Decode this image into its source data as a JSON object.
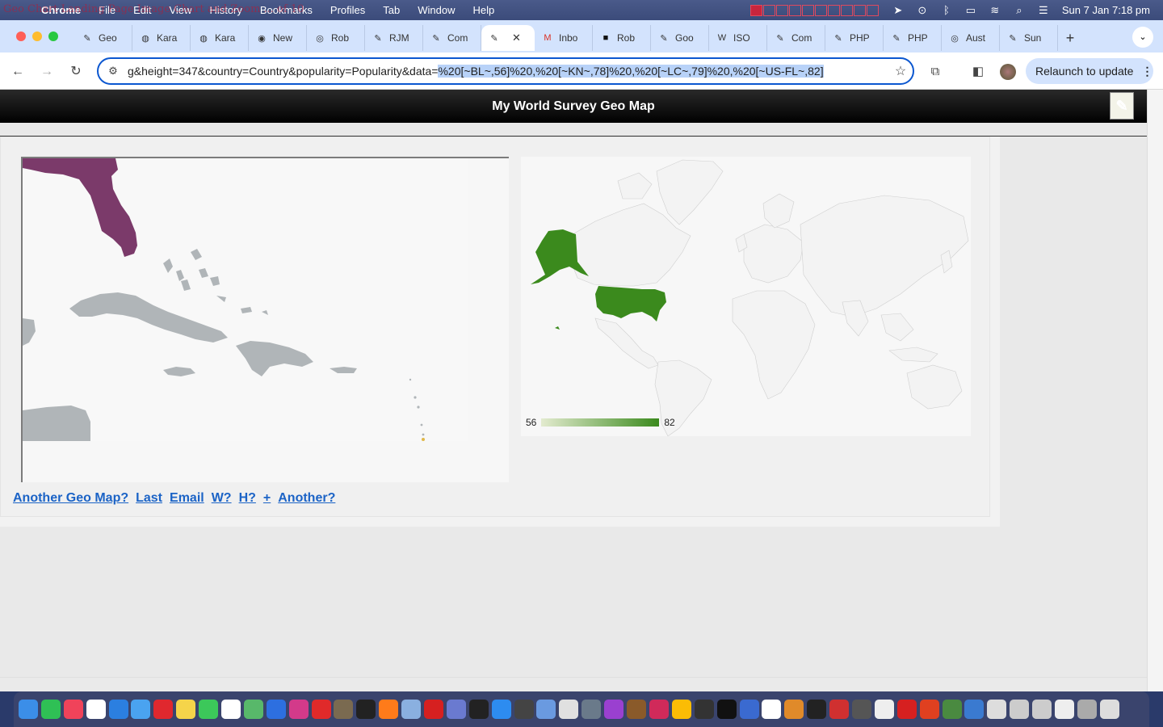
{
  "menubar": {
    "overlay_text": "Geo Chart Landing Page Image Chart and Zoom ... of 10",
    "items": [
      "Chrome",
      "File",
      "Edit",
      "View",
      "History",
      "Bookmarks",
      "Profiles",
      "Tab",
      "Window",
      "Help"
    ],
    "clock": "Sun 7 Jan  7:18 pm"
  },
  "tabs": [
    {
      "label": "Geo",
      "icon": "pencil-favicon-icon"
    },
    {
      "label": "Kara",
      "icon": "globe-favicon-icon"
    },
    {
      "label": "Kara",
      "icon": "globe-favicon-icon"
    },
    {
      "label": "New",
      "icon": "chrome-favicon-icon"
    },
    {
      "label": "Rob",
      "icon": "circle-favicon-icon"
    },
    {
      "label": "RJM",
      "icon": "pencil-favicon-icon"
    },
    {
      "label": "Com",
      "icon": "pencil-favicon-icon"
    },
    {
      "label": "",
      "icon": "pencil-favicon-icon",
      "active": true
    },
    {
      "label": "Inbo",
      "icon": "gmail-favicon-icon"
    },
    {
      "label": "Rob",
      "icon": "dark-favicon-icon"
    },
    {
      "label": "Goo",
      "icon": "pencil-favicon-icon"
    },
    {
      "label": "ISO",
      "icon": "wikipedia-favicon-icon"
    },
    {
      "label": "Com",
      "icon": "pencil-favicon-icon"
    },
    {
      "label": "PHP",
      "icon": "pencil-favicon-icon"
    },
    {
      "label": "PHP",
      "icon": "pencil-favicon-icon"
    },
    {
      "label": "Aust",
      "icon": "circle-favicon-icon"
    },
    {
      "label": "Sun",
      "icon": "pencil-favicon-icon"
    }
  ],
  "address": {
    "url_prefix": "g&height=347&country=Country&popularity=Popularity&data=",
    "url_selected": "%20[~BL~,56]%20,%20[~KN~,78]%20,%20[~LC~,79]%20,%20[~US-FL~,82]"
  },
  "toolbar": {
    "relaunch_label": "Relaunch to update"
  },
  "page": {
    "title": "My World Survey Geo Map",
    "legend_min": "56",
    "legend_max": "82",
    "links": [
      "Another Geo Map?",
      "Last",
      "Email",
      "W?",
      "H?",
      "+",
      "Another?"
    ]
  },
  "map_data": {
    "regions": [
      {
        "code": "BL",
        "value": 56
      },
      {
        "code": "KN",
        "value": 78
      },
      {
        "code": "LC",
        "value": 79
      },
      {
        "code": "US-FL",
        "value": 82
      }
    ],
    "colors": {
      "highlight_region": "#7b3a6a",
      "other_land": "#b0b5b8",
      "world_highlight": "#3b8a1d",
      "world_land": "#f3f3f3",
      "legend_low": "#e3ebcf",
      "legend_high": "#3b8a1d"
    }
  }
}
